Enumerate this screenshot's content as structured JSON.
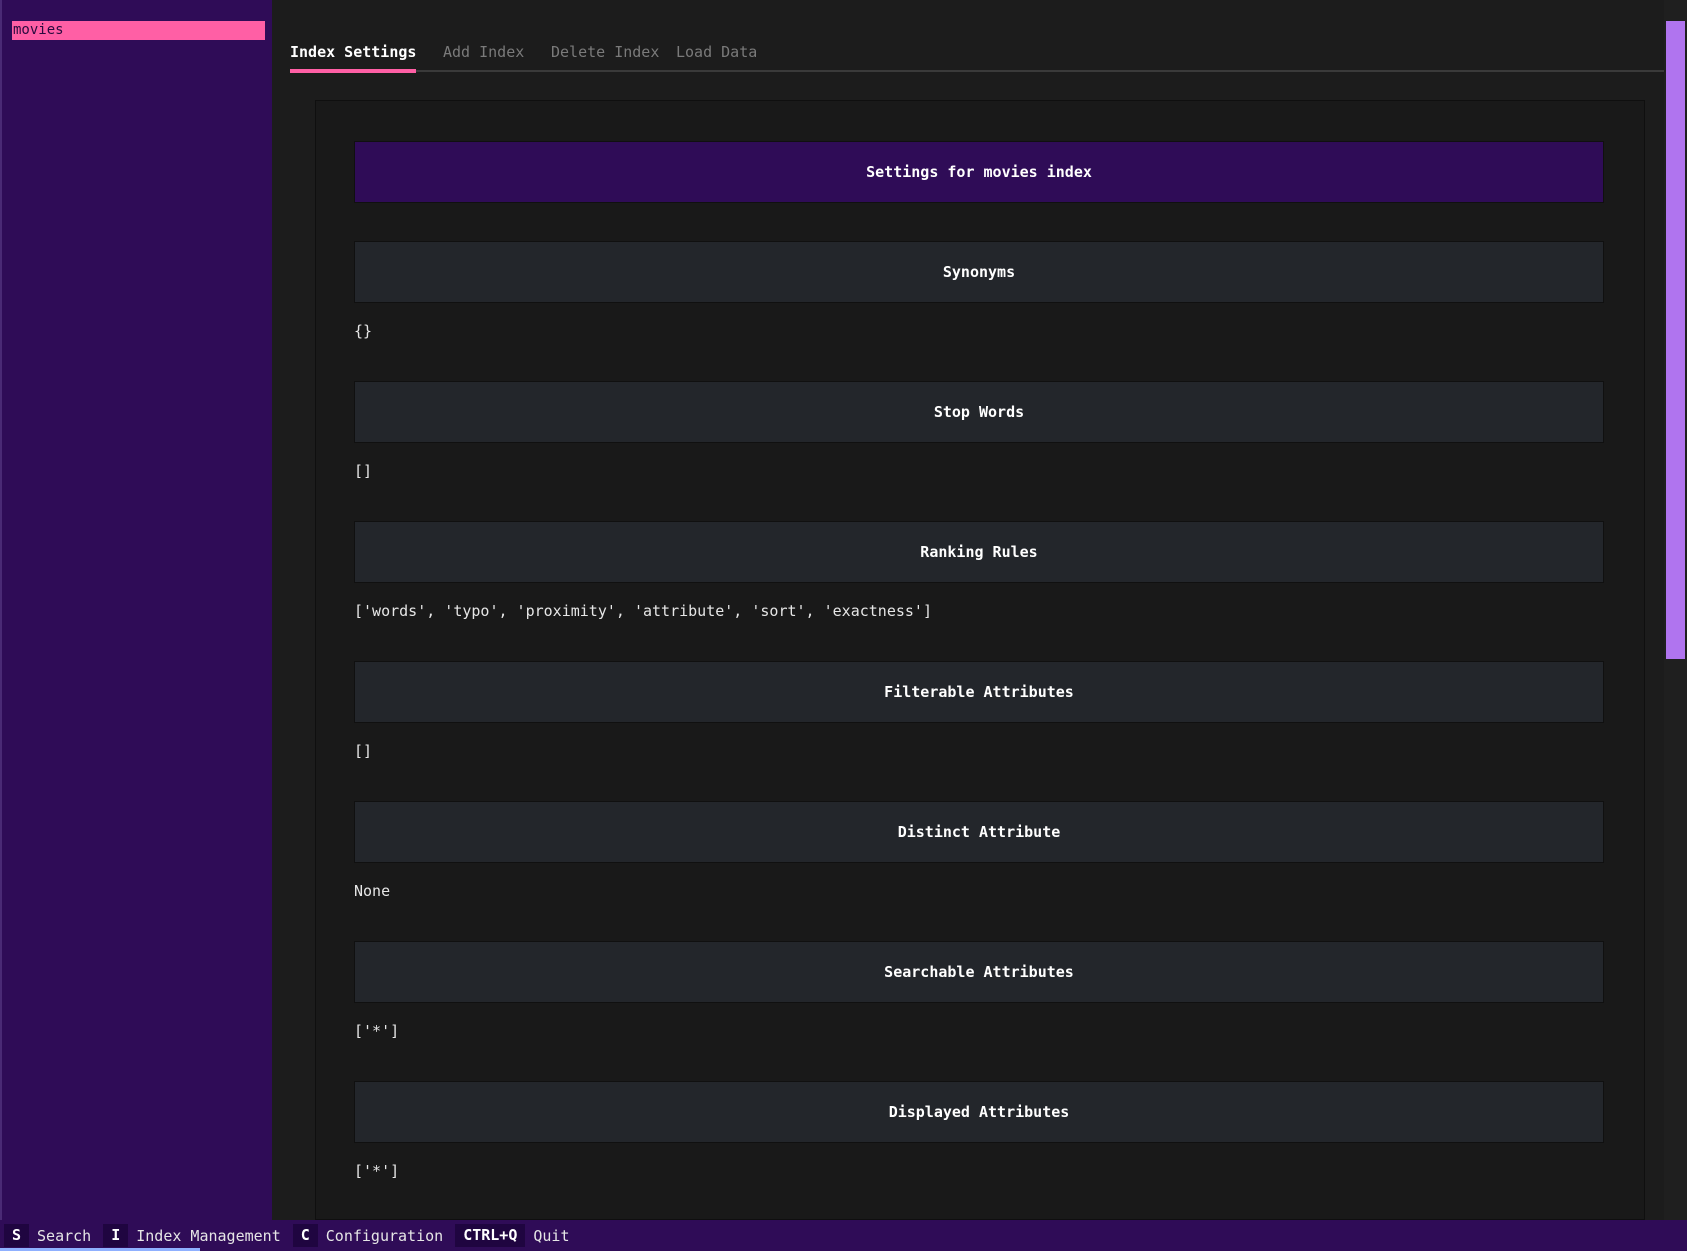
{
  "sidebar": {
    "indexes": [
      {
        "label": "movies"
      }
    ]
  },
  "tabs": [
    {
      "label": "Index Settings",
      "active": true
    },
    {
      "label": "Add Index",
      "active": false
    },
    {
      "label": "Delete Index",
      "active": false
    },
    {
      "label": "Load Data",
      "active": false
    }
  ],
  "panel": {
    "title": "Settings for movies index",
    "settings": [
      {
        "header": "Synonyms",
        "value": "{}"
      },
      {
        "header": "Stop Words",
        "value": "[]"
      },
      {
        "header": "Ranking Rules",
        "value": "['words', 'typo', 'proximity', 'attribute', 'sort', 'exactness']"
      },
      {
        "header": "Filterable Attributes",
        "value": "[]"
      },
      {
        "header": "Distinct Attribute",
        "value": "None"
      },
      {
        "header": "Searchable Attributes",
        "value": "['*']"
      },
      {
        "header": "Displayed Attributes",
        "value": "['*']"
      }
    ]
  },
  "footer": {
    "bindings": [
      {
        "key": "S",
        "label": "Search"
      },
      {
        "key": "I",
        "label": "Index Management"
      },
      {
        "key": "C",
        "label": "Configuration"
      },
      {
        "key": "CTRL+Q",
        "label": "Quit"
      }
    ]
  },
  "colors": {
    "accent_pink": "#ff5fa5",
    "purple": "#2f0c57",
    "scrollbar": "#b074ef"
  }
}
